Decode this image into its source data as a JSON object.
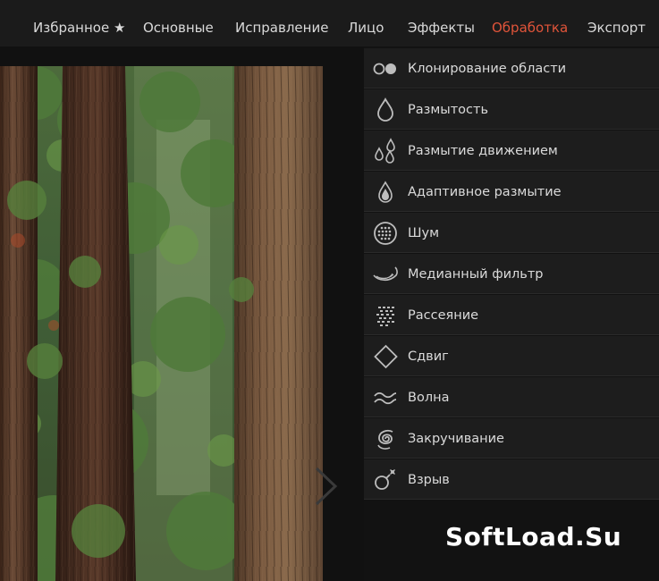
{
  "nav": {
    "items": [
      {
        "label": "Избранное ★",
        "active": false
      },
      {
        "label": "Основные",
        "active": false
      },
      {
        "label": "Исправление",
        "active": false
      },
      {
        "label": "Лицо",
        "active": false
      },
      {
        "label": "Эффекты",
        "active": false
      },
      {
        "label": "Обработка",
        "active": true
      },
      {
        "label": "Экспорт",
        "active": false
      }
    ]
  },
  "menu": {
    "items": [
      {
        "label": "Клонирование области",
        "icon": "clone-icon"
      },
      {
        "label": "Размытость",
        "icon": "blur-drop-icon"
      },
      {
        "label": "Размытие движением",
        "icon": "motion-blur-icon"
      },
      {
        "label": "Адаптивное размытие",
        "icon": "adaptive-blur-icon"
      },
      {
        "label": "Шум",
        "icon": "noise-icon"
      },
      {
        "label": "Медианный фильтр",
        "icon": "median-filter-icon"
      },
      {
        "label": "Рассеяние",
        "icon": "scatter-icon"
      },
      {
        "label": "Сдвиг",
        "icon": "shift-diamond-icon"
      },
      {
        "label": "Волна",
        "icon": "wave-icon"
      },
      {
        "label": "Закручивание",
        "icon": "swirl-icon"
      },
      {
        "label": "Взрыв",
        "icon": "explosion-icon"
      }
    ]
  },
  "watermark": "SoftLoad.Su",
  "colors": {
    "active": "#e0543a",
    "text": "#dadada",
    "menu_bg": "#1d1d1d"
  }
}
